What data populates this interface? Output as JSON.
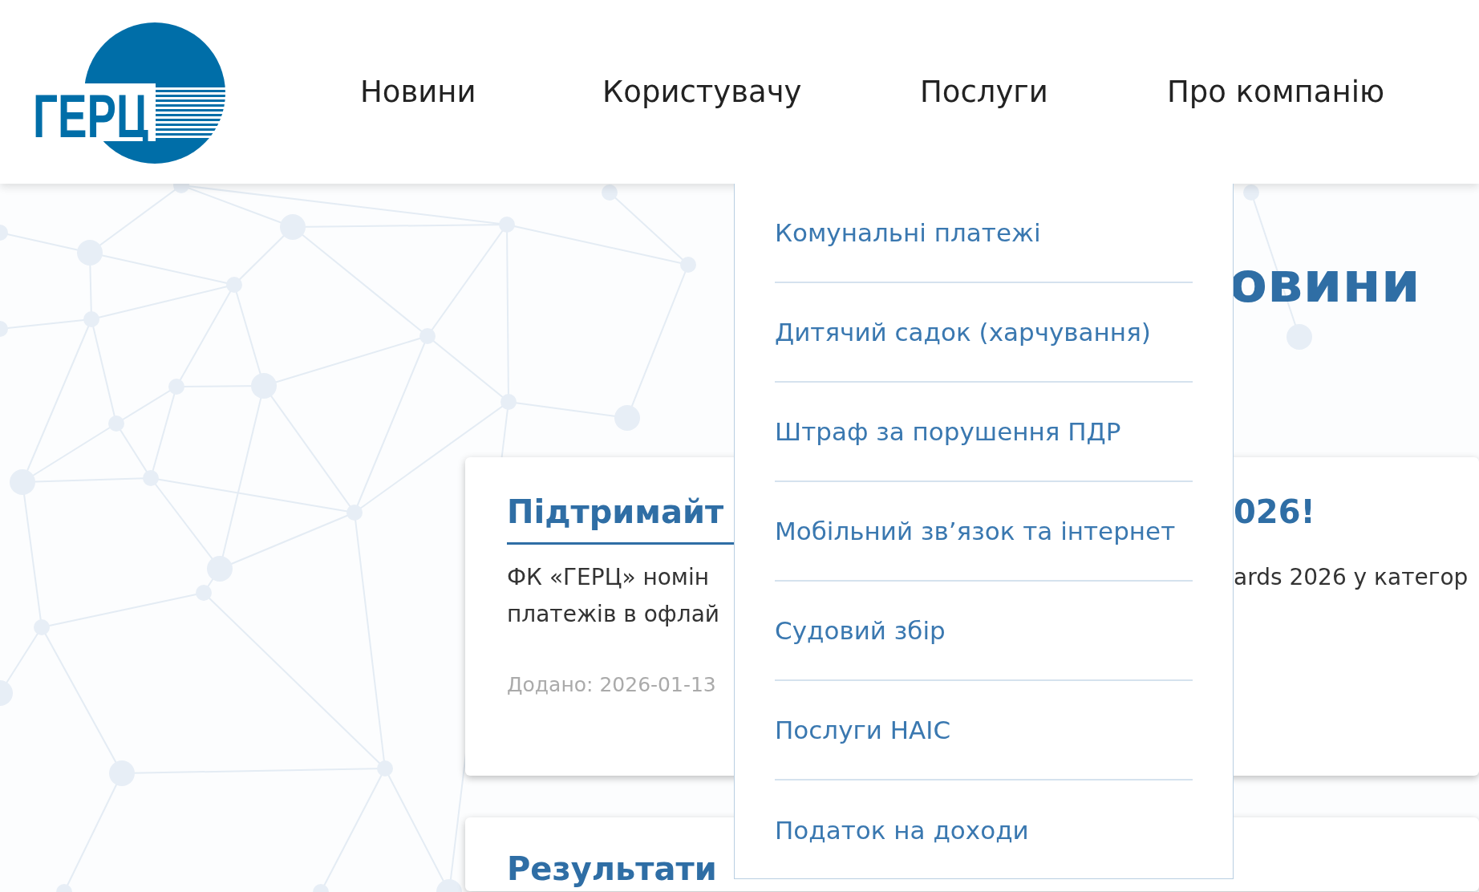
{
  "header": {
    "logo_text": "ГЕРЦ",
    "nav": [
      {
        "label": "Новини"
      },
      {
        "label": "Користувачу"
      },
      {
        "label": "Послуги"
      },
      {
        "label": "Про компанію"
      }
    ]
  },
  "dropdown": {
    "items": [
      "Комунальні платежі",
      "Дитячий садок (харчування)",
      "Штраф за порушення ПДР",
      "Мобільний зв’язок та інтернет",
      "Судовий збір",
      "Послуги НАІС",
      "Податок на доходи"
    ]
  },
  "page_heading": "овини",
  "cards": [
    {
      "title_left": "Підтримайт",
      "title_right": "026!",
      "body_left": [
        "ФК «ГЕРЦ» номін",
        "платежів в офлай"
      ],
      "body_right": [
        "ards 2026 у категор"
      ],
      "date": "Додано: 2026-01-13"
    },
    {
      "title_left": "Результати"
    }
  ]
}
